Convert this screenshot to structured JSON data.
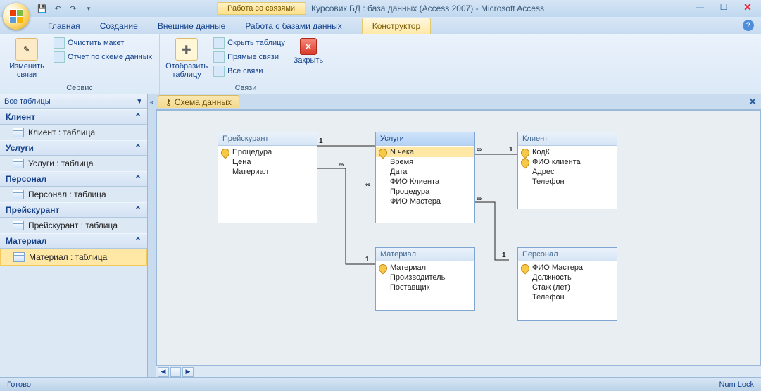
{
  "titlebar": {
    "contextual_label": "Работа со связями",
    "title": "Курсовик БД : база данных (Access 2007) - Microsoft Access"
  },
  "tabs": {
    "home": "Главная",
    "create": "Создание",
    "external": "Внешние данные",
    "dbtools": "Работа с базами данных",
    "designer": "Конструктор"
  },
  "ribbon": {
    "group_service": "Сервис",
    "group_links": "Связи",
    "edit_rel": "Изменить связи",
    "clear_layout": "Очистить макет",
    "rel_report": "Отчет по схеме данных",
    "show_table": "Отобразить таблицу",
    "hide_table": "Скрыть таблицу",
    "direct_links": "Прямые связи",
    "all_links": "Все связи",
    "close": "Закрыть"
  },
  "nav": {
    "header": "Все таблицы",
    "groups": [
      {
        "name": "Клиент",
        "item": "Клиент : таблица"
      },
      {
        "name": "Услуги",
        "item": "Услуги : таблица"
      },
      {
        "name": "Персонал",
        "item": "Персонал : таблица"
      },
      {
        "name": "Прейскурант",
        "item": "Прейскурант : таблица"
      },
      {
        "name": "Материал",
        "item": "Материал : таблица"
      }
    ]
  },
  "doc_tab": "Схема данных",
  "entities": {
    "price": {
      "title": "Прейскурант",
      "f0": "Процедура",
      "f1": "Цена",
      "f2": "Материал"
    },
    "service": {
      "title": "Услуги",
      "f0": "N чека",
      "f1": "Время",
      "f2": "Дата",
      "f3": "ФИО Клиента",
      "f4": "Процедура",
      "f5": "ФИО Мастера"
    },
    "client": {
      "title": "Клиент",
      "f0": "КодК",
      "f1": "ФИО клиента",
      "f2": "Адрес",
      "f3": "Телефон"
    },
    "material": {
      "title": "Материал",
      "f0": "Материал",
      "f1": "Производитель",
      "f2": "Поставщик"
    },
    "staff": {
      "title": "Персонал",
      "f0": "ФИО Мастера",
      "f1": "Должность",
      "f2": "Стаж (лет)",
      "f3": "Телефон"
    }
  },
  "cardinality": {
    "one": "1",
    "many": "∞"
  },
  "status": {
    "ready": "Готово",
    "numlock": "Num Lock"
  }
}
